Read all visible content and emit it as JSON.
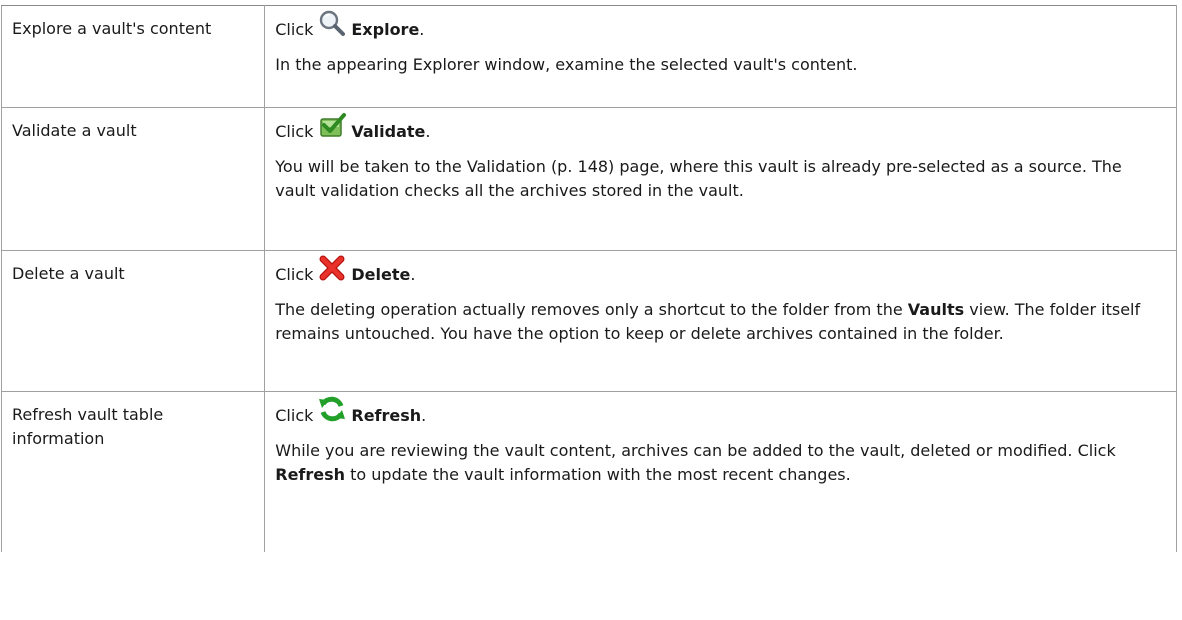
{
  "rows": [
    {
      "action": "Explore a vault's content",
      "click_word": "Click",
      "icon": "search-icon",
      "command": "Explore",
      "period": ".",
      "description": "In the appearing Explorer window, examine the selected vault's content."
    },
    {
      "action": "Validate a vault",
      "click_word": "Click",
      "icon": "validate-check-icon",
      "command": "Validate",
      "period": ".",
      "description": "You will be taken to the Validation (p. 148) page, where this vault is already pre-selected as a source. The vault validation checks all the archives stored in the vault."
    },
    {
      "action": "Delete a vault",
      "click_word": "Click",
      "icon": "delete-x-icon",
      "command": "Delete",
      "period": ".",
      "description_parts": {
        "a": "The deleting operation actually removes only a shortcut to the folder from the",
        "b": "Vaults",
        "c": "view. The folder itself remains untouched. You have the option to keep or delete archives contained in the folder."
      }
    },
    {
      "action": "Refresh vault table information",
      "click_word": "Click",
      "icon": "refresh-icon",
      "command": "Refresh",
      "period": ".",
      "description_parts": {
        "a": "While you are reviewing the vault content, archives can be added to the vault, deleted or modified. Click",
        "b": "Refresh",
        "c": "to update the vault information with the most recent changes."
      }
    }
  ],
  "colors": {
    "border": "#a0a0a0",
    "text": "#1a1a1a",
    "delete_red": "#d9201c",
    "refresh_green": "#2aa82a",
    "check_green": "#3aa52f"
  }
}
